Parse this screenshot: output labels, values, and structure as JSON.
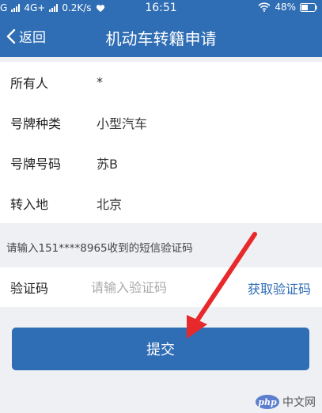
{
  "status_bar": {
    "carrier_g": "G",
    "network": "4G+",
    "speed": "0.2K/s",
    "time": "16:51",
    "battery": "48%"
  },
  "nav": {
    "back_label": "返回",
    "title": "机动车转籍申请"
  },
  "form": {
    "rows": [
      {
        "label": "所有人",
        "value": "*"
      },
      {
        "label": "号牌种类",
        "value": "小型汽车"
      },
      {
        "label": "号牌号码",
        "value": "苏B"
      },
      {
        "label": "转入地",
        "value": "北京"
      }
    ]
  },
  "sms_tip": "请输入151****8965收到的短信验证码",
  "verification": {
    "label": "验证码",
    "placeholder": "请输入验证码",
    "value": "",
    "get_code_label": "获取验证码"
  },
  "submit_label": "提交",
  "watermark": {
    "logo": "php",
    "text": "中文网"
  },
  "colors": {
    "brand": "#2f6db5",
    "annotation_arrow": "#e8292b",
    "background": "#eef0f3"
  },
  "icons": {
    "back": "chevron-left-icon",
    "wifi": "wifi-icon",
    "battery": "battery-icon",
    "signal": "signal-icon"
  }
}
